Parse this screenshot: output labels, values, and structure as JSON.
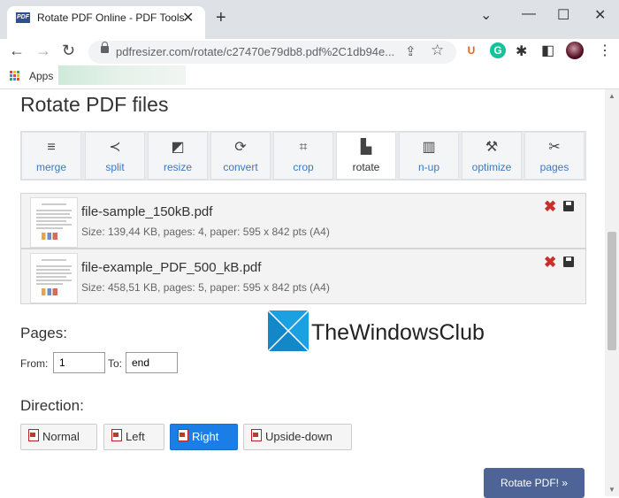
{
  "browser": {
    "tab": {
      "favicon_text": "PDF",
      "title": "Rotate PDF Online - PDF Tools",
      "close_glyph": "✕"
    },
    "new_tab_glyph": "+",
    "window_controls": {
      "collapse": "⌄",
      "minimize": "—",
      "maximize": "☐",
      "close": "✕"
    },
    "nav": {
      "back": "←",
      "forward": "→",
      "reload": "↻"
    },
    "url": "pdfresizer.com/rotate/c27470e79db8.pdf%2C1db94e...",
    "toolbar_icons": {
      "share": "⇪",
      "star": "☆",
      "ext_u": "U",
      "ext_g": "G",
      "puzzle": "✱",
      "sidebar": "◧",
      "menu": "⋮"
    },
    "bookmarks": {
      "apps_label": "Apps"
    }
  },
  "page": {
    "title": "Rotate PDF files",
    "tools": [
      {
        "label": "merge",
        "icon": "≡"
      },
      {
        "label": "split",
        "icon": "≺"
      },
      {
        "label": "resize",
        "icon": "◩"
      },
      {
        "label": "convert",
        "icon": "⟳"
      },
      {
        "label": "crop",
        "icon": "⌗"
      },
      {
        "label": "rotate",
        "icon": "▙"
      },
      {
        "label": "n-up",
        "icon": "▥"
      },
      {
        "label": "optimize",
        "icon": "⚒"
      },
      {
        "label": "pages",
        "icon": "✂"
      }
    ],
    "active_tool": "rotate",
    "files": [
      {
        "name": "file-sample_150kB.pdf",
        "meta": "Size: 139,44 KB, pages: 4, paper: 595 x 842 pts (A4)"
      },
      {
        "name": "file-example_PDF_500_kB.pdf",
        "meta": "Size: 458,51 KB, pages: 5, paper: 595 x 842 pts (A4)"
      }
    ],
    "file_delete_glyph": "✖",
    "pages_section": {
      "heading": "Pages:",
      "from_label": "From:",
      "from_value": "1",
      "to_label": "To:",
      "to_value": "end"
    },
    "direction_section": {
      "heading": "Direction:",
      "options": [
        "Normal",
        "Left",
        "Right",
        "Upside-down"
      ],
      "selected": "Right"
    },
    "submit_label": "Rotate PDF! »",
    "watermark": "TheWindowsClub"
  },
  "colors": {
    "accent": "#1a7ee6",
    "submit": "#4e6497",
    "link": "#3a78c3"
  }
}
